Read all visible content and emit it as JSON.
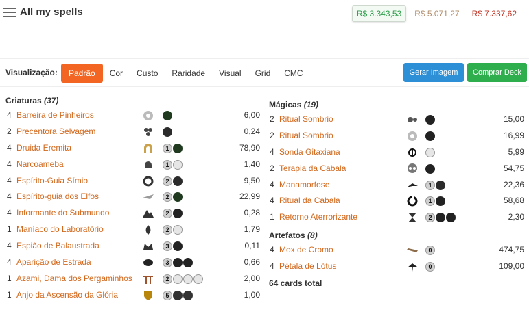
{
  "header": {
    "title": "All my spells",
    "prices": [
      "R$ 3.343,53",
      "R$ 5.071,27",
      "R$ 7.337,62"
    ]
  },
  "toolbar": {
    "label": "Visualização:",
    "tabs": [
      "Padrão",
      "Cor",
      "Custo",
      "Raridade",
      "Visual",
      "Grid",
      "CMC"
    ],
    "active_tab": "Padrão",
    "buttons": [
      "Gerar Imagem",
      "Comprar Deck"
    ]
  },
  "sections": {
    "creatures": {
      "title": "Criaturas",
      "count": "(37)",
      "cards": [
        {
          "qty": "4",
          "name": "Barreira de Pinheiros",
          "set": "flower-set-icon",
          "mana": [
            "G"
          ],
          "price": "6,00"
        },
        {
          "qty": "2",
          "name": "Precentora Selvagem",
          "set": "cluster-set-icon",
          "mana": [
            "R"
          ],
          "price": "0,24"
        },
        {
          "qty": "4",
          "name": "Druida Eremita",
          "set": "arch-set-icon",
          "mana": [
            "1",
            "G"
          ],
          "price": "78,90"
        },
        {
          "qty": "4",
          "name": "Narcoameba",
          "set": "helm-set-icon",
          "mana": [
            "1",
            "U"
          ],
          "price": "1,40"
        },
        {
          "qty": "4",
          "name": "Espírito-Guia Símio",
          "set": "ring-set-icon",
          "mana": [
            "2",
            "R"
          ],
          "price": "9,50"
        },
        {
          "qty": "4",
          "name": "Espírito-guia dos Elfos",
          "set": "wing-set-icon",
          "mana": [
            "2",
            "G"
          ],
          "price": "22,99"
        },
        {
          "qty": "4",
          "name": "Informante do Submundo",
          "set": "mountain-set-icon",
          "mana": [
            "2",
            "B"
          ],
          "price": "0,28"
        },
        {
          "qty": "1",
          "name": "Maníaco do Laboratório",
          "set": "flame-set-icon",
          "mana": [
            "2",
            "U"
          ],
          "price": "1,79"
        },
        {
          "qty": "4",
          "name": "Espião de Balaustrada",
          "set": "crown-set-icon",
          "mana": [
            "3",
            "B"
          ],
          "price": "0,11"
        },
        {
          "qty": "4",
          "name": "Aparição de Estrada",
          "set": "shard-set-icon",
          "mana": [
            "3",
            "B",
            "B"
          ],
          "price": "0,66"
        },
        {
          "qty": "1",
          "name": "Azami, Dama dos Pergaminhos",
          "set": "torii-set-icon",
          "mana": [
            "2",
            "U",
            "U",
            "U"
          ],
          "price": "2,00"
        },
        {
          "qty": "1",
          "name": "Anjo da Ascensão da Glória",
          "set": "shield-set-icon",
          "mana": [
            "5",
            "W",
            "W"
          ],
          "price": "1,00"
        }
      ]
    },
    "sorceries": {
      "title": "Mágicas",
      "count": "(19)",
      "cards": [
        {
          "qty": "2",
          "name": "Ritual Sombrio",
          "set": "gears-set-icon",
          "mana": [
            "B"
          ],
          "price": "15,00"
        },
        {
          "qty": "2",
          "name": "Ritual Sombrio",
          "set": "flower-set-icon",
          "mana": [
            "B"
          ],
          "price": "16,99"
        },
        {
          "qty": "4",
          "name": "Sonda Gitaxiana",
          "set": "phi-set-icon",
          "mana": [
            "U"
          ],
          "price": "5,99"
        },
        {
          "qty": "2",
          "name": "Terapia da Cabala",
          "set": "skull-set-icon",
          "mana": [
            "B"
          ],
          "price": "54,75"
        },
        {
          "qty": "4",
          "name": "Manamorfose",
          "set": "bird-set-icon",
          "mana": [
            "1",
            "R"
          ],
          "price": "22,36"
        },
        {
          "qty": "4",
          "name": "Ritual da Cabala",
          "set": "swirl-set-icon",
          "mana": [
            "1",
            "B"
          ],
          "price": "58,68"
        },
        {
          "qty": "1",
          "name": "Retorno Aterrorizante",
          "set": "hourglass-set-icon",
          "mana": [
            "2",
            "B",
            "B"
          ],
          "price": "2,30"
        }
      ]
    },
    "artifacts": {
      "title": "Artefatos",
      "count": "(8)",
      "cards": [
        {
          "qty": "4",
          "name": "Mox de Cromo",
          "set": "blade-set-icon",
          "mana": [
            "0"
          ],
          "price": "474,75"
        },
        {
          "qty": "4",
          "name": "Pétala de Lótus",
          "set": "tree-set-icon",
          "mana": [
            "0"
          ],
          "price": "109,00"
        }
      ]
    },
    "total": "64 cards total"
  }
}
